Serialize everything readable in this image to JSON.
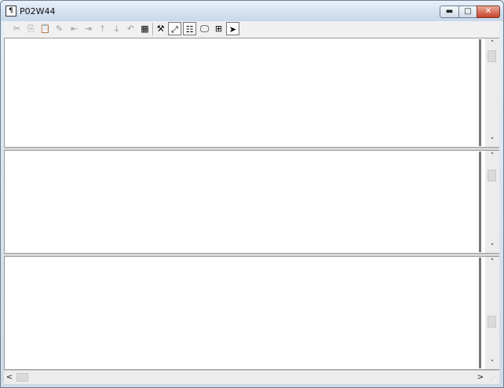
{
  "window": {
    "title": "P02W44",
    "app_icon_glyph": "¶",
    "buttons": {
      "minimize": "▬",
      "maximize": "□",
      "close": "✕"
    }
  },
  "toolbar": {
    "tools": [
      {
        "name": "cut-icon",
        "glyph": "✂",
        "enabled": false
      },
      {
        "name": "copy-icon",
        "glyph": "⎘",
        "enabled": false
      },
      {
        "name": "paste-icon",
        "glyph": "📋",
        "enabled": false
      },
      {
        "name": "edit-icon",
        "glyph": "✎",
        "enabled": false
      },
      {
        "name": "align-left-icon",
        "glyph": "⇤",
        "enabled": false
      },
      {
        "name": "align-right-icon",
        "glyph": "⇥",
        "enabled": false
      },
      {
        "name": "align-top-icon",
        "glyph": "⤒",
        "enabled": false
      },
      {
        "name": "align-bottom-icon",
        "glyph": "⤓",
        "enabled": false
      },
      {
        "name": "undo-icon",
        "glyph": "↶",
        "enabled": false
      },
      {
        "name": "grid-icon",
        "glyph": "▦",
        "enabled": true
      },
      {
        "name": "tools-icon",
        "glyph": "⚒",
        "enabled": true
      },
      {
        "name": "resize-icon",
        "glyph": "⤢",
        "enabled": true
      },
      {
        "name": "list-icon",
        "glyph": "☷",
        "enabled": true
      },
      {
        "name": "monitor-icon",
        "glyph": "🖵",
        "enabled": true
      },
      {
        "name": "tree-icon",
        "glyph": "⊞",
        "enabled": true
      },
      {
        "name": "pointer-icon",
        "glyph": "➤",
        "enabled": true
      }
    ]
  },
  "scroll": {
    "up": "˄",
    "down": "˅",
    "left": "<",
    "right": ">"
  },
  "grip": "⋰"
}
